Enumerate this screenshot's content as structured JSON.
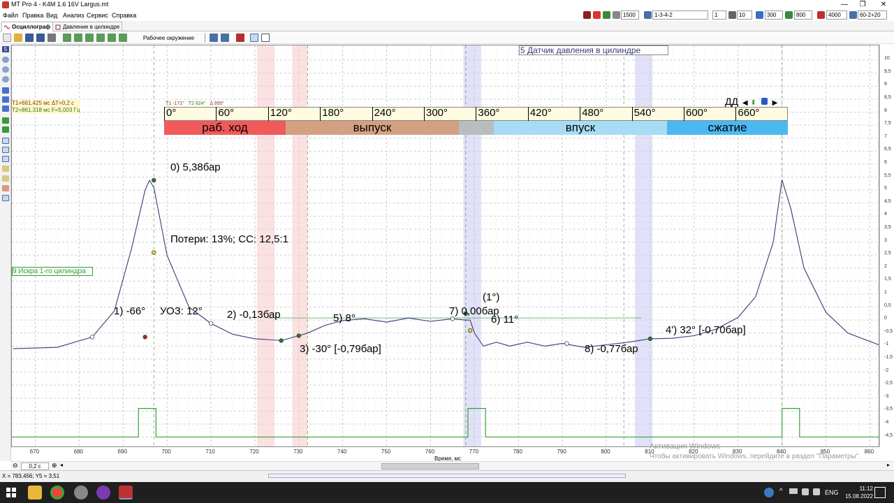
{
  "window": {
    "title": "MT Pro 4 - K4M 1.6 16V Largus.mt",
    "minimize": "—",
    "maximize": "❐",
    "close": "✕"
  },
  "menu": [
    "Файл",
    "Правка",
    "Вид",
    "Анализ",
    "Сервис",
    "Справка"
  ],
  "toolbar_top": {
    "rpm": "1500",
    "cyl_order": "1-3-4-2",
    "cyl": "1",
    "div1": "10",
    "v300": "300",
    "v800": "800",
    "v4000": "4000",
    "range": "60-2+20"
  },
  "tabs": [
    {
      "label": "Осциллограф"
    },
    {
      "label": "Давление в цилиндре"
    }
  ],
  "toolbar2": {
    "env_label": "Рабочее окружение"
  },
  "left_badge": "5",
  "cursor_info": {
    "t1": "T1=661,425 мс ΔT=0,2 с",
    "t2": "T2=861,318 мс F=5,003 Гц"
  },
  "channels": {
    "pressure_title": "Датчик давления в цилиндре",
    "pressure_num": "5",
    "spark_label": "9 Искра 1-го цилиндра"
  },
  "deg_panel": {
    "title": "ДД",
    "ticks": [
      "0°",
      "60°",
      "120°",
      "180°",
      "240°",
      "300°",
      "360°",
      "420°",
      "480°",
      "540°",
      "600°",
      "660°"
    ],
    "mini": [
      "T1 -171°",
      "T2 824°",
      "Δ 995°"
    ],
    "phases": [
      {
        "label": "раб. ход",
        "color": "#f05a5a"
      },
      {
        "label": "выпуск",
        "color": "#d4a082"
      },
      {
        "label": "",
        "color": "#b8bec0"
      },
      {
        "label": "впуск",
        "color": "#a8dcf4"
      },
      {
        "label": "сжатие",
        "color": "#4cb8f0"
      }
    ]
  },
  "markers": [
    {
      "text": "0)  5,38бар"
    },
    {
      "text": "Потери: 13%; CC: 12,5:1"
    },
    {
      "text": "1)  -66°"
    },
    {
      "text": "УОЗ: 12°"
    },
    {
      "text": "2)  -0,13бар"
    },
    {
      "text": "3)  -30° [-0,79бар]"
    },
    {
      "text": "5)  8°"
    },
    {
      "text": "7)  0,00бар"
    },
    {
      "text": "(1°)"
    },
    {
      "text": "6)  11°"
    },
    {
      "text": "8)  -0,77бар"
    },
    {
      "text": "4')  32° [-0,70бар]"
    }
  ],
  "chart_data": {
    "type": "line",
    "xlabel": "Время, мс",
    "ylabel": "",
    "xlim": [
      665,
      862
    ],
    "ylim": [
      -4.7,
      10.3
    ],
    "x_ticks": [
      670,
      680,
      690,
      700,
      710,
      720,
      730,
      740,
      750,
      760,
      770,
      780,
      790,
      800,
      810,
      820,
      830,
      840,
      850,
      860
    ],
    "y_ticks": [
      "10",
      "9,5",
      "9",
      "8,5",
      "8",
      "7,5",
      "7",
      "6,5",
      "6",
      "5,5",
      "5",
      "4,5",
      "4",
      "3,5",
      "3",
      "2,5",
      "2",
      "1,5",
      "1",
      "0,5",
      "0",
      "-0,5",
      "-1",
      "-1,5",
      "-2",
      "-2,5",
      "-3",
      "-3,5",
      "-4",
      "-4,5"
    ],
    "series": [
      {
        "color": "#3a3a7a",
        "x": [
          665,
          675,
          683,
          688,
          692,
          695,
          696,
          697,
          700,
          705,
          710,
          715,
          720,
          726,
          730,
          732,
          736,
          740,
          745,
          750,
          755,
          760,
          765,
          768,
          769,
          770,
          772,
          775,
          778,
          782,
          786,
          790,
          795,
          800,
          805,
          810,
          815,
          820,
          825,
          830,
          834,
          838,
          840,
          842,
          845,
          850,
          855,
          862
        ],
        "y": [
          -1.1,
          -1.05,
          -0.65,
          0.35,
          2.8,
          5.0,
          5.38,
          5.1,
          2.5,
          0.5,
          -0.13,
          -0.55,
          -0.72,
          -0.79,
          -0.6,
          -0.5,
          -0.2,
          -0.02,
          0.05,
          -0.08,
          0.08,
          -0.05,
          0.05,
          0.0,
          0.0,
          -0.5,
          -1.0,
          -0.85,
          -1.0,
          -0.85,
          -1.0,
          -0.9,
          -1.05,
          -0.95,
          -0.85,
          -0.72,
          -0.7,
          -0.6,
          -0.35,
          0.1,
          0.9,
          3.0,
          5.4,
          4.3,
          2.0,
          0.3,
          -0.5,
          -0.95
        ]
      }
    ],
    "spark_pulses": [
      [
        693.5,
        697.5
      ],
      [
        768.5,
        772.5
      ],
      [
        840,
        844
      ]
    ]
  },
  "right_axis_ticks": [
    "10",
    "9,5",
    "9",
    "8,5",
    "8",
    "7,5",
    "7",
    "6,5",
    "6",
    "5,5",
    "5",
    "4,5",
    "4",
    "3,5",
    "3",
    "2,5",
    "2",
    "1,5",
    "1",
    "0,5",
    "0",
    "-0,5",
    "-1",
    "-1,5",
    "-2",
    "-2,5",
    "-3",
    "-3,5",
    "-4",
    "-4,5"
  ],
  "scroll": {
    "zoom": "0,2 с"
  },
  "status": {
    "coords": "X = 783,456; Y5 = 3,51"
  },
  "watermark": {
    "line1": "Активация Windows",
    "line2": "Чтобы активировать Windows, перейдите в раздел \"Параметры\"."
  },
  "tray": {
    "lang": "ENG",
    "time": "11:12",
    "date": "15.08.2022"
  }
}
